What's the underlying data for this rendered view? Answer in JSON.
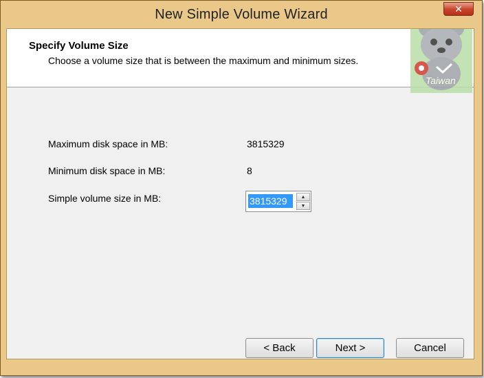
{
  "window": {
    "title": "New Simple Volume Wizard",
    "close_glyph": "✕"
  },
  "header": {
    "title": "Specify Volume Size",
    "subtitle": "Choose a volume size that is between the maximum and minimum sizes."
  },
  "watermark": {
    "text": "Taiwan"
  },
  "fields": {
    "max_label": "Maximum disk space in MB:",
    "max_value": "3815329",
    "min_label": "Minimum disk space in MB:",
    "min_value": "8",
    "size_label": "Simple volume size in MB:",
    "size_value": "3815329"
  },
  "buttons": {
    "back": "< Back",
    "next": "Next >",
    "cancel": "Cancel"
  },
  "icons": {
    "spin_up": "▲",
    "spin_down": "▼"
  },
  "colors": {
    "frame": "#e9c88a",
    "selection": "#3399ff",
    "close": "#c8432b"
  }
}
